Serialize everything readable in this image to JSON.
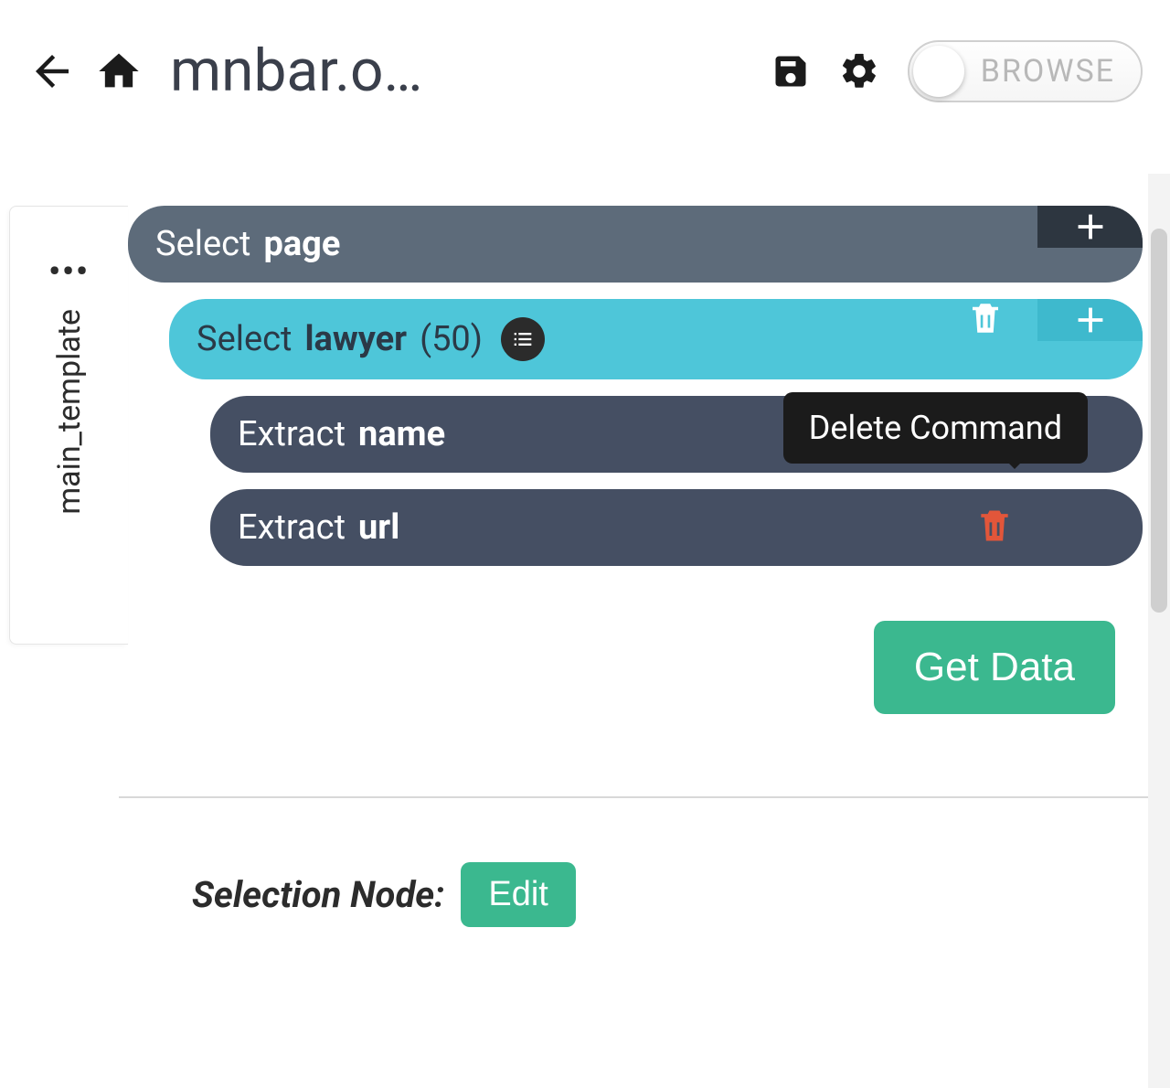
{
  "toolbar": {
    "title": "mnbar.o…",
    "toggle_label": "BROWSE"
  },
  "sidebar": {
    "tab_label": "main_template",
    "dots": "•••"
  },
  "commands": {
    "page": {
      "action": "Select",
      "target": "page"
    },
    "lawyer": {
      "action": "Select",
      "target": "lawyer",
      "count": "(50)"
    },
    "name": {
      "action": "Extract",
      "target": "name"
    },
    "url": {
      "action": "Extract",
      "target": "url"
    }
  },
  "tooltip": {
    "delete": "Delete Command"
  },
  "buttons": {
    "get_data": "Get Data",
    "edit": "Edit"
  },
  "selection_node_label": "Selection Node:"
}
